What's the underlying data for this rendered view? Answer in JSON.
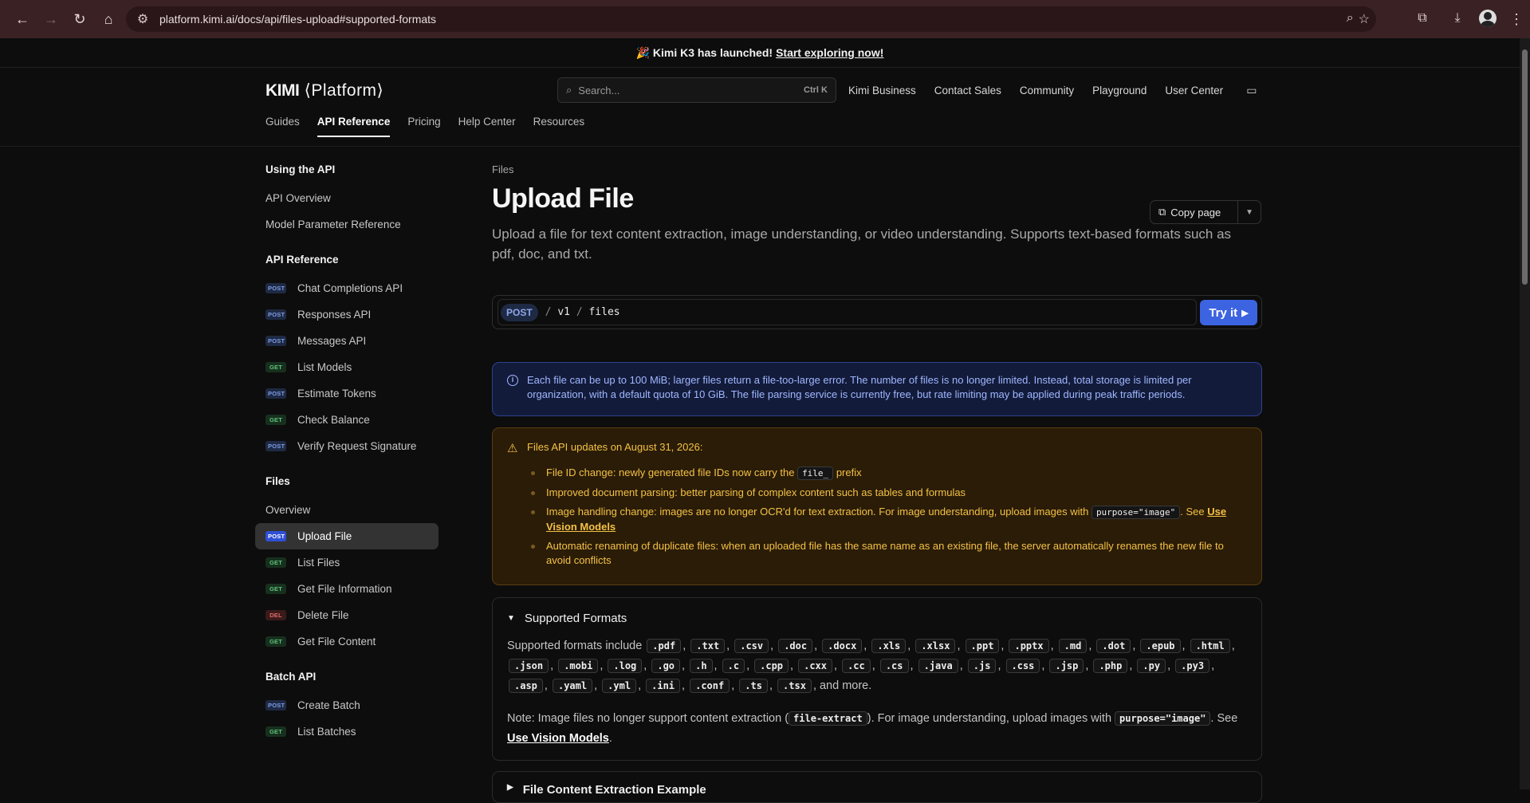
{
  "browser": {
    "url": "platform.kimi.ai/docs/api/files-upload#supported-formats"
  },
  "banner": {
    "text": "🎉 Kimi K3 has launched!",
    "link": "Start exploring now!"
  },
  "header": {
    "logo_main": "KIMI",
    "logo_sub": "⟨Platform⟩",
    "search_placeholder": "Search...",
    "search_shortcut": "Ctrl K",
    "links": [
      "Kimi Business",
      "Contact Sales",
      "Community",
      "Playground",
      "User Center"
    ],
    "tabs": [
      "Guides",
      "API Reference",
      "Pricing",
      "Help Center",
      "Resources"
    ]
  },
  "sidebar": {
    "using": {
      "title": "Using the API",
      "items": [
        "API Overview",
        "Model Parameter Reference"
      ]
    },
    "api": {
      "title": "API Reference",
      "items": [
        {
          "method": "POST",
          "label": "Chat Completions API"
        },
        {
          "method": "POST",
          "label": "Responses API"
        },
        {
          "method": "POST",
          "label": "Messages API"
        },
        {
          "method": "GET",
          "label": "List Models"
        },
        {
          "method": "POST",
          "label": "Estimate Tokens"
        },
        {
          "method": "GET",
          "label": "Check Balance"
        },
        {
          "method": "POST",
          "label": "Verify Request Signature"
        }
      ]
    },
    "files": {
      "title": "Files",
      "overview": "Overview",
      "items": [
        {
          "method": "POST",
          "label": "Upload File"
        },
        {
          "method": "GET",
          "label": "List Files"
        },
        {
          "method": "GET",
          "label": "Get File Information"
        },
        {
          "method": "DEL",
          "label": "Delete File"
        },
        {
          "method": "GET",
          "label": "Get File Content"
        }
      ]
    },
    "batch": {
      "title": "Batch API",
      "items": [
        {
          "method": "POST",
          "label": "Create Batch"
        },
        {
          "method": "GET",
          "label": "List Batches"
        }
      ]
    }
  },
  "main": {
    "crumb": "Files",
    "title": "Upload File",
    "copy_label": "Copy page",
    "description": "Upload a file for text content extraction, image understanding, or video understanding. Supports text-based formats such as pdf, doc, and txt.",
    "method": "POST",
    "path_v": "v1",
    "path_r": "files",
    "try_label": "Try it",
    "info": "Each file can be up to 100 MiB; larger files return a file-too-large error. The number of files is no longer limited. Instead, total storage is limited per organization, with a default quota of 10 GiB. The file parsing service is currently free, but rate limiting may be applied during peak traffic periods.",
    "warn_title": "Files API updates on August 31, 2026:",
    "warn_1a": "File ID change: newly generated file IDs now carry the",
    "warn_1code": "file_",
    "warn_1b": "prefix",
    "warn_2": "Improved document parsing: better parsing of complex content such as tables and formulas",
    "warn_3a": "Image handling change: images are no longer OCR'd for text extraction. For image understanding, upload images with",
    "warn_3code": "purpose=\"image\"",
    "warn_3b": ". See",
    "warn_3link": "Use Vision Models",
    "warn_4": "Automatic renaming of duplicate files: when an uploaded file has the same name as an existing file, the server automatically renames the new file to avoid conflicts",
    "formats_title": "Supported Formats",
    "formats_lead": "Supported formats include",
    "formats": [
      ".pdf",
      ".txt",
      ".csv",
      ".doc",
      ".docx",
      ".xls",
      ".xlsx",
      ".ppt",
      ".pptx",
      ".md",
      ".dot",
      ".epub",
      ".html",
      ".json",
      ".mobi",
      ".log",
      ".go",
      ".h",
      ".c",
      ".cpp",
      ".cxx",
      ".cc",
      ".cs",
      ".java",
      ".js",
      ".css",
      ".jsp",
      ".php",
      ".py",
      ".py3",
      ".asp",
      ".yaml",
      ".yml",
      ".ini",
      ".conf",
      ".ts",
      ".tsx"
    ],
    "formats_tail": ", and more.",
    "note_a": "Note: Image files no longer support content extraction (",
    "note_code1": "file-extract",
    "note_b": "). For image understanding, upload images with",
    "note_code2": "purpose=\"image\"",
    "note_c": ". See",
    "note_link": "Use Vision Models",
    "note_d": ".",
    "next_title": "File Content Extraction Example"
  }
}
